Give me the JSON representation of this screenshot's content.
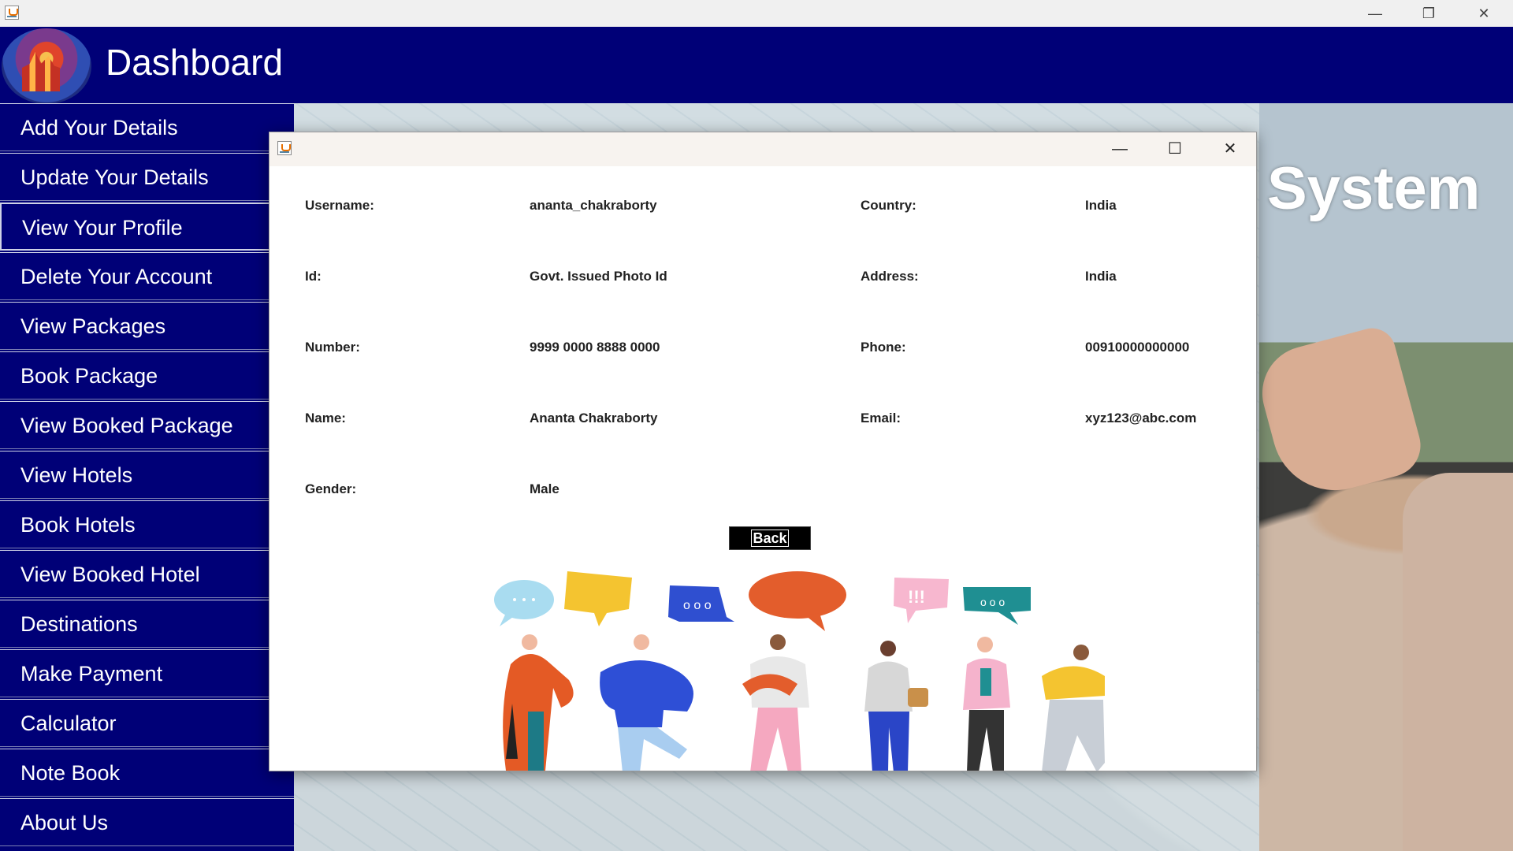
{
  "app": {
    "header_title": "Dashboard",
    "window_controls": {
      "minimize": "—",
      "restore": "❐",
      "close": "✕"
    }
  },
  "sidebar": {
    "items": [
      {
        "label": "Add Your Details"
      },
      {
        "label": "Update Your Details"
      },
      {
        "label": "View Your Profile",
        "active": true
      },
      {
        "label": "Delete Your Account"
      },
      {
        "label": "View Packages"
      },
      {
        "label": "Book Package"
      },
      {
        "label": "View Booked Package"
      },
      {
        "label": "View Hotels"
      },
      {
        "label": "Book Hotels"
      },
      {
        "label": "View Booked Hotel"
      },
      {
        "label": "Destinations"
      },
      {
        "label": "Make Payment"
      },
      {
        "label": "Calculator"
      },
      {
        "label": "Note Book"
      },
      {
        "label": "About Us"
      }
    ]
  },
  "background": {
    "visible_text": "System"
  },
  "dialog": {
    "controls": {
      "minimize": "—",
      "maximize": "☐",
      "close": "✕"
    },
    "fields": {
      "username": {
        "label": "Username:",
        "value": "ananta_chakraborty"
      },
      "id": {
        "label": "Id:",
        "value": "Govt. Issued Photo Id"
      },
      "number": {
        "label": "Number:",
        "value": "9999 0000 8888 0000"
      },
      "name": {
        "label": "Name:",
        "value": "Ananta Chakraborty"
      },
      "gender": {
        "label": "Gender:",
        "value": "Male"
      },
      "country": {
        "label": "Country:",
        "value": "India"
      },
      "address": {
        "label": "Address:",
        "value": "India"
      },
      "phone": {
        "label": "Phone:",
        "value": "00910000000000"
      },
      "email": {
        "label": "Email:",
        "value": "xyz123@abc.com"
      }
    },
    "back_button": "Back"
  },
  "colors": {
    "header_bg": "#000077",
    "sidebar_bg": "#000077",
    "dialog_bg": "#ffffff",
    "button_bg": "#000000"
  }
}
